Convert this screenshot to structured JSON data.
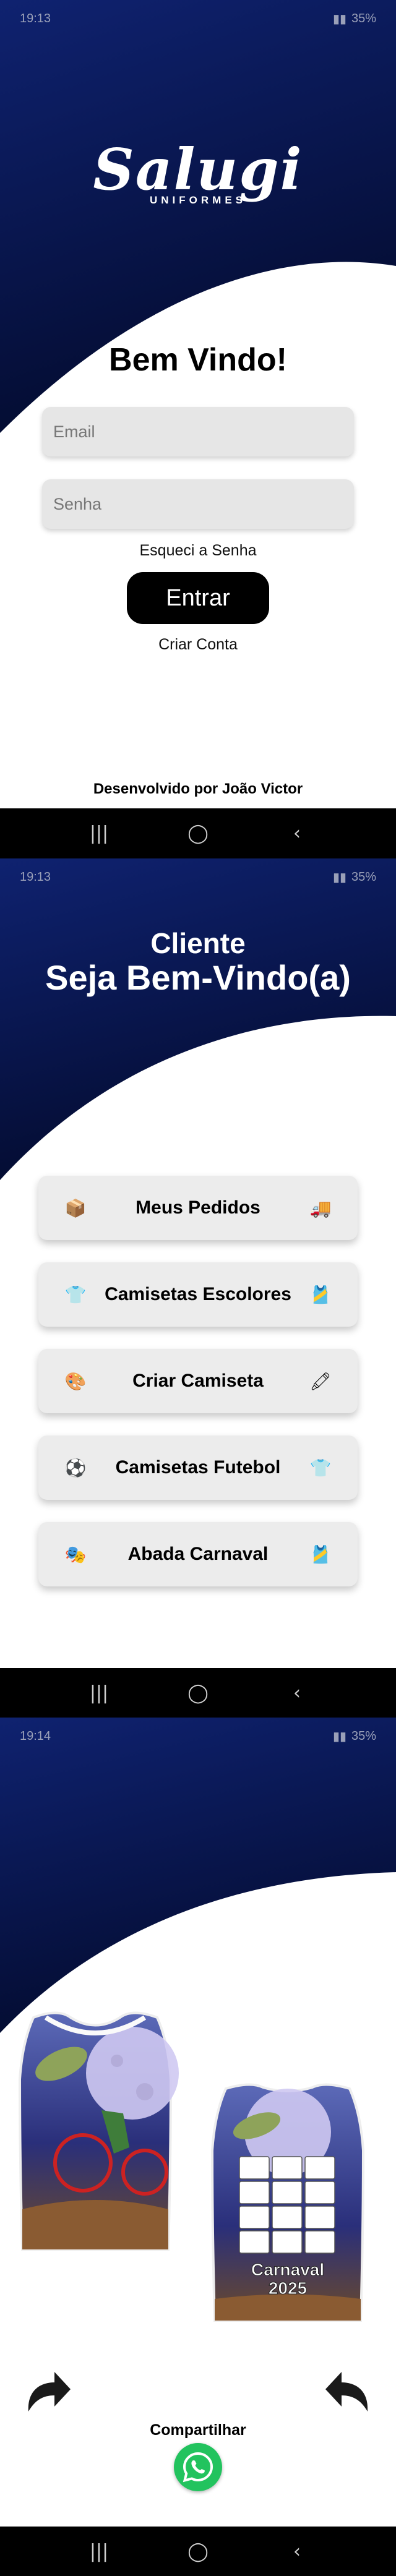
{
  "colors": {
    "navy": "#0e1e66",
    "navy_dark": "#030b2e",
    "button_black": "#000000",
    "whatsapp": "#22c35e"
  },
  "screen1": {
    "status": {
      "time": "19:13",
      "battery": "35%"
    },
    "logo": {
      "brand": "Salugi",
      "sub": "UNIFORMES"
    },
    "title": "Bem Vindo!",
    "email_placeholder": "Email",
    "password_placeholder": "Senha",
    "forgot": "Esqueci a Senha",
    "enter": "Entrar",
    "create": "Criar Conta",
    "footer": "Desenvolvido por João Victor"
  },
  "screen2": {
    "status": {
      "time": "19:13",
      "battery": "35%"
    },
    "title": "Cliente",
    "subtitle": "Seja Bem-Vindo(a)",
    "menu": [
      {
        "label": "Meus Pedidos",
        "left_icon": "📦",
        "right_icon": "🚚"
      },
      {
        "label": "Camisetas Escolores",
        "left_icon": "👕",
        "right_icon": "🎽"
      },
      {
        "label": "Criar Camiseta",
        "left_icon": "🎨",
        "right_icon": "🖍"
      },
      {
        "label": "Camisetas Futebol",
        "left_icon": "⚽",
        "right_icon": "👕"
      },
      {
        "label": "Abada Carnaval",
        "left_icon": "🎭",
        "right_icon": "🎽"
      }
    ]
  },
  "screen3": {
    "status": {
      "time": "19:14",
      "battery": "35%"
    },
    "shirt_text_1": "Carnaval",
    "shirt_text_2": "2025",
    "share": "Compartilhar"
  },
  "navbar": {
    "recent": "|||",
    "home": "◯",
    "back": "‹"
  }
}
